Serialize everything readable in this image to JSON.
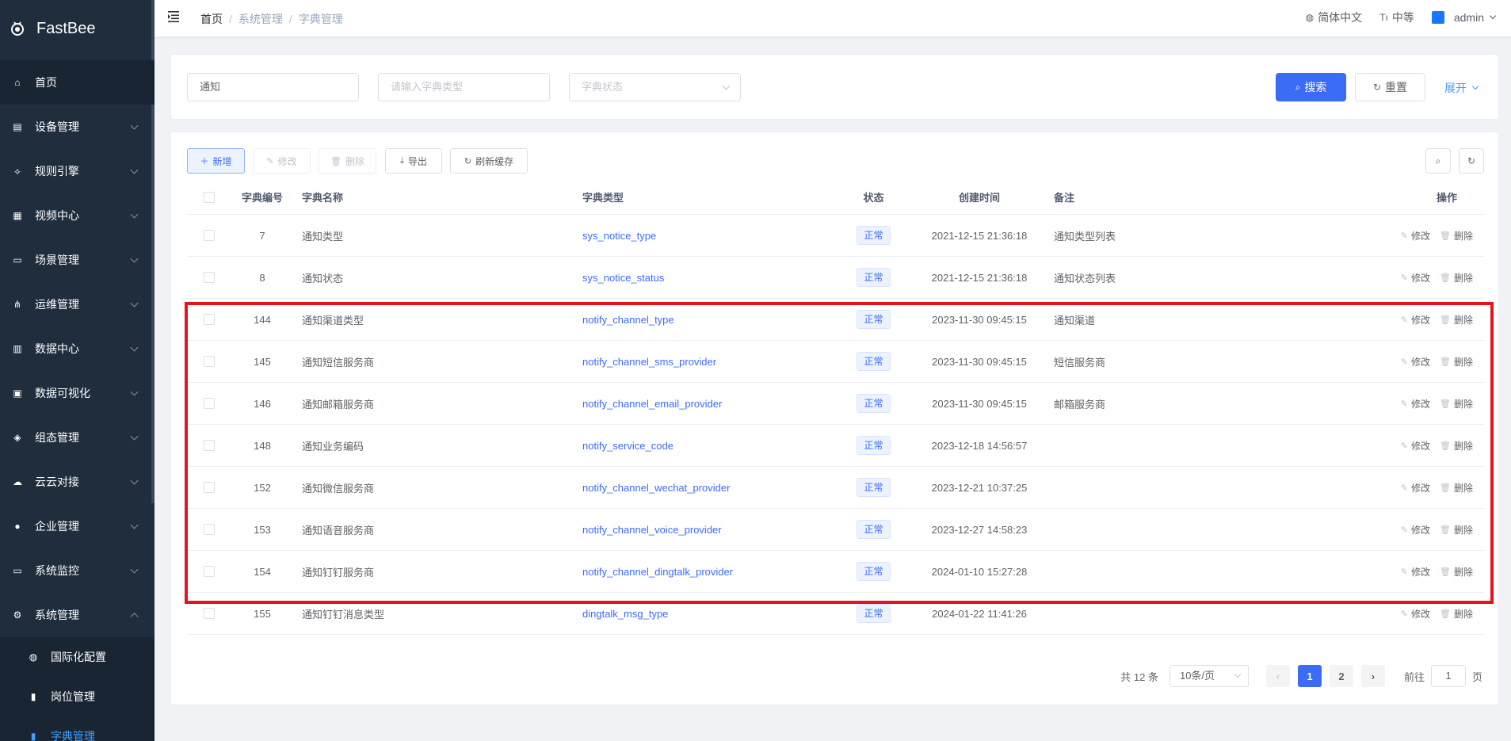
{
  "app": {
    "name": "FastBee"
  },
  "sidebar": {
    "items": [
      {
        "label": "首页",
        "icon": "home-icon",
        "glyph": "⌂"
      },
      {
        "label": "设备管理",
        "icon": "device-icon",
        "glyph": "▤"
      },
      {
        "label": "规则引擎",
        "icon": "rule-icon",
        "glyph": "⟡"
      },
      {
        "label": "视频中心",
        "icon": "video-icon",
        "glyph": "▦"
      },
      {
        "label": "场景管理",
        "icon": "scene-icon",
        "glyph": "▭"
      },
      {
        "label": "运维管理",
        "icon": "ops-icon",
        "glyph": "⋔"
      },
      {
        "label": "数据中心",
        "icon": "data-icon",
        "glyph": "▥"
      },
      {
        "label": "数据可视化",
        "icon": "visual-icon",
        "glyph": "▣"
      },
      {
        "label": "组态管理",
        "icon": "layers-icon",
        "glyph": "◈"
      },
      {
        "label": "云云对接",
        "icon": "cloud-icon",
        "glyph": "☁"
      },
      {
        "label": "企业管理",
        "icon": "enterprise-icon",
        "glyph": "●"
      },
      {
        "label": "系统监控",
        "icon": "monitor-icon",
        "glyph": "▭"
      },
      {
        "label": "系统管理",
        "icon": "settings-icon",
        "glyph": "⚙"
      }
    ],
    "submenu": [
      {
        "label": "国际化配置",
        "icon": "globe-icon",
        "glyph": "◍"
      },
      {
        "label": "岗位管理",
        "icon": "post-icon",
        "glyph": "▮"
      },
      {
        "label": "字典管理",
        "icon": "book-icon",
        "glyph": "▮"
      }
    ]
  },
  "navbar": {
    "breadcrumb": [
      "首页",
      "系统管理",
      "字典管理"
    ],
    "language": "简体中文",
    "font_size": "中等",
    "user": "admin"
  },
  "search": {
    "name_value": "通知",
    "type_placeholder": "请输入字典类型",
    "status_placeholder": "字典状态",
    "search_label": "搜索",
    "reset_label": "重置",
    "expand_label": "展开"
  },
  "toolbar": {
    "add_label": "新增",
    "edit_label": "修改",
    "delete_label": "删除",
    "export_label": "导出",
    "refresh_cache_label": "刷新缓存"
  },
  "table": {
    "headers": {
      "id": "字典编号",
      "name": "字典名称",
      "type": "字典类型",
      "status": "状态",
      "created": "创建时间",
      "remark": "备注",
      "ops": "操作"
    },
    "op_edit": "修改",
    "op_delete": "删除",
    "rows": [
      {
        "id": "7",
        "name": "通知类型",
        "type": "sys_notice_type",
        "status": "正常",
        "created": "2021-12-15 21:36:18",
        "remark": "通知类型列表"
      },
      {
        "id": "8",
        "name": "通知状态",
        "type": "sys_notice_status",
        "status": "正常",
        "created": "2021-12-15 21:36:18",
        "remark": "通知状态列表"
      },
      {
        "id": "144",
        "name": "通知渠道类型",
        "type": "notify_channel_type",
        "status": "正常",
        "created": "2023-11-30 09:45:15",
        "remark": "通知渠道"
      },
      {
        "id": "145",
        "name": "通知短信服务商",
        "type": "notify_channel_sms_provider",
        "status": "正常",
        "created": "2023-11-30 09:45:15",
        "remark": "短信服务商"
      },
      {
        "id": "146",
        "name": "通知邮箱服务商",
        "type": "notify_channel_email_provider",
        "status": "正常",
        "created": "2023-11-30 09:45:15",
        "remark": "邮箱服务商"
      },
      {
        "id": "148",
        "name": "通知业务编码",
        "type": "notify_service_code",
        "status": "正常",
        "created": "2023-12-18 14:56:57",
        "remark": ""
      },
      {
        "id": "152",
        "name": "通知微信服务商",
        "type": "notify_channel_wechat_provider",
        "status": "正常",
        "created": "2023-12-21 10:37:25",
        "remark": ""
      },
      {
        "id": "153",
        "name": "通知语音服务商",
        "type": "notify_channel_voice_provider",
        "status": "正常",
        "created": "2023-12-27 14:58:23",
        "remark": ""
      },
      {
        "id": "154",
        "name": "通知钉钉服务商",
        "type": "notify_channel_dingtalk_provider",
        "status": "正常",
        "created": "2024-01-10 15:27:28",
        "remark": ""
      },
      {
        "id": "155",
        "name": "通知钉钉消息类型",
        "type": "dingtalk_msg_type",
        "status": "正常",
        "created": "2024-01-22 11:41:26",
        "remark": ""
      }
    ]
  },
  "pagination": {
    "total": "共 12 条",
    "page_size": "10条/页",
    "pages": [
      "1",
      "2"
    ],
    "current": "1",
    "goto_prefix": "前往",
    "goto_value": "1",
    "goto_suffix": "页"
  },
  "colors": {
    "sidebar": "#1f2d3d",
    "primary": "#3b6cf5",
    "highlight": "#e3141b"
  }
}
